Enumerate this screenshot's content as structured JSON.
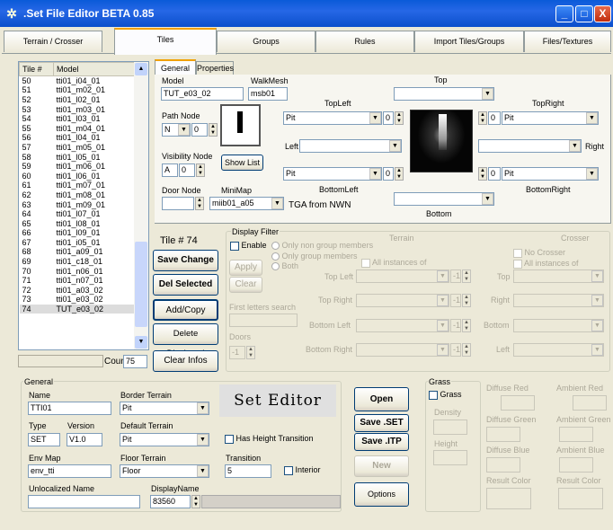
{
  "window": {
    "title": ".Set File Editor BETA 0.85",
    "min": "_",
    "max": "□",
    "close": "X"
  },
  "tabs": [
    "Terrain / Crosser",
    "Tiles",
    "Groups",
    "Rules",
    "Import Tiles/Groups",
    "Files/Textures"
  ],
  "list": {
    "headers": [
      "Tile #",
      "Model"
    ],
    "rows": [
      [
        "50",
        "tti01_i04_01"
      ],
      [
        "51",
        "tti01_m02_01"
      ],
      [
        "52",
        "tti01_l02_01"
      ],
      [
        "53",
        "tti01_m03_01"
      ],
      [
        "54",
        "tti01_l03_01"
      ],
      [
        "55",
        "tti01_m04_01"
      ],
      [
        "56",
        "tti01_l04_01"
      ],
      [
        "57",
        "tti01_m05_01"
      ],
      [
        "58",
        "tti01_l05_01"
      ],
      [
        "59",
        "tti01_m06_01"
      ],
      [
        "60",
        "tti01_l06_01"
      ],
      [
        "61",
        "tti01_m07_01"
      ],
      [
        "62",
        "tti01_m08_01"
      ],
      [
        "63",
        "tti01_m09_01"
      ],
      [
        "64",
        "tti01_l07_01"
      ],
      [
        "65",
        "tti01_l08_01"
      ],
      [
        "66",
        "tti01_l09_01"
      ],
      [
        "67",
        "tti01_i05_01"
      ],
      [
        "68",
        "tti01_a09_01"
      ],
      [
        "69",
        "tti01_c18_01"
      ],
      [
        "70",
        "tti01_n06_01"
      ],
      [
        "71",
        "tti01_n07_01"
      ],
      [
        "72",
        "tti01_a03_02"
      ],
      [
        "73",
        "tti01_e03_02"
      ],
      [
        "74",
        "TUT_e03_02"
      ]
    ],
    "count_label": "Count",
    "count_value": "75"
  },
  "subtabs": [
    "General",
    "Properties"
  ],
  "general": {
    "model_label": "Model",
    "model_value": "TUT_e03_02",
    "walkmesh_label": "WalkMesh",
    "walkmesh_value": "msb01",
    "pathnode_label": "Path Node",
    "pathnode_value": "N",
    "pathnode_num": "0",
    "visnode_label": "Visibility Node",
    "visnode_value": "A",
    "visnode_num": "0",
    "doornode_label": "Door Node",
    "minimap_label": "MiniMap",
    "minimap_value": "miib01_a05",
    "tga_label": "TGA from NWN",
    "showlist": "Show List"
  },
  "edges": {
    "top_label": "Top",
    "topleft_label": "TopLeft",
    "topright_label": "TopRight",
    "left_label": "Left",
    "right_label": "Right",
    "bottomleft_label": "BottomLeft",
    "bottomright_label": "BottomRight",
    "bottom_label": "Bottom",
    "topleft_value": "Pit",
    "topleft_num": "0",
    "topright_value": "Pit",
    "topright_num": "0",
    "bottomleft_value": "Pit",
    "bottomleft_num": "0",
    "bottomright_value": "Pit",
    "bottomright_num": "0"
  },
  "actions": {
    "tile_label": "Tile # 74",
    "save": "Save Change",
    "del": "Del Selected",
    "add": "Add/Copy",
    "delete_displayed": "Delete Displayed",
    "clear_infos": "Clear Infos"
  },
  "filter": {
    "title": "Display Filter",
    "enable": "Enable",
    "opt1": "Only non group members",
    "opt2": "Only group members",
    "opt3": "Both",
    "apply": "Apply",
    "clear": "Clear",
    "first_letters": "First letters search",
    "doors": "Doors",
    "doors_value": "-1",
    "terrain": "Terrain",
    "crosser": "Crosser",
    "all_instances": "All instances of",
    "no_crosser": "No Crosser",
    "all_instances2": "All instances of",
    "top_left": "Top Left",
    "top_right": "Top Right",
    "bottom_left": "Bottom Left",
    "bottom_right": "Bottom Right",
    "top": "Top",
    "right": "Right",
    "bottom": "Bottom",
    "left": "Left",
    "spin_value": "-1"
  },
  "general_box": {
    "title": "General",
    "name_label": "Name",
    "name_value": "TTI01",
    "border_label": "Border Terrain",
    "border_value": "Pit",
    "type_label": "Type",
    "type_value": "SET",
    "version_label": "Version",
    "version_value": "V1.0",
    "default_label": "Default Terrain",
    "default_value": "Pit",
    "height_trans": "Has Height Transition",
    "envmap_label": "Env Map",
    "envmap_value": "env_tti",
    "floor_label": "Floor Terrain",
    "floor_value": "Floor",
    "transition_label": "Transition",
    "transition_value": "5",
    "interior": "Interior",
    "unloc_label": "Unlocalized Name",
    "display_label": "DisplayName",
    "display_value": "83560",
    "logo": "Set Editor"
  },
  "file_btns": {
    "open": "Open",
    "save_set": "Save .SET",
    "save_itp": "Save .ITP",
    "new": "New",
    "options": "Options"
  },
  "grass": {
    "title": "Grass",
    "grass": "Grass",
    "density": "Density",
    "height": "Height",
    "diffuse_red": "Diffuse Red",
    "ambient_red": "Ambient Red",
    "diffuse_green": "Diffuse Green",
    "ambient_green": "Ambient Green",
    "diffuse_blue": "Diffuse Blue",
    "ambient_blue": "Ambient Blue",
    "result_color": "Result Color",
    "result_color2": "Result Color"
  }
}
